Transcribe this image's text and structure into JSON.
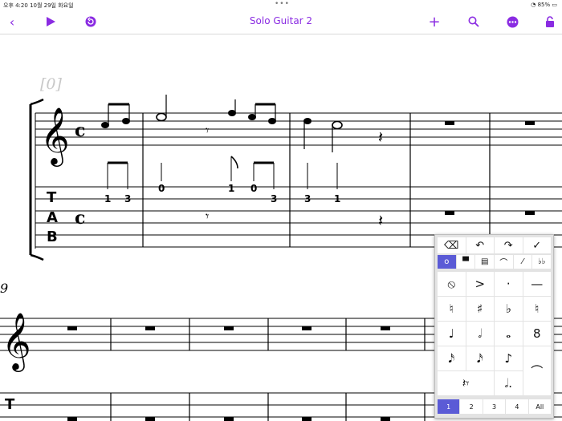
{
  "status": {
    "time": "오후 4:20",
    "date": "10월 29일 화요일",
    "dots": "•••",
    "wifi": "wifi-icon",
    "battery": "85%"
  },
  "toolbar": {
    "title": "Solo Guitar 2",
    "back_icon": "‹",
    "play_icon": "▶",
    "undo_icon": "↶",
    "add_icon": "+",
    "search_icon": "⌕",
    "more_icon": "•••",
    "lock_icon": "🔓"
  },
  "score": {
    "bar_label": "[0]",
    "system2_number": "9",
    "time_signature": "𝄴",
    "tab_label": [
      "T",
      "A",
      "B"
    ],
    "tab_numbers": [
      "1",
      "3",
      "0",
      "1",
      "0",
      "3",
      "3",
      "1"
    ]
  },
  "palette": {
    "top_row": [
      "⌫",
      "↶",
      "↷",
      "✓"
    ],
    "tabs": [
      "𝅝",
      "𝄼",
      "▤",
      "⌒",
      "⁄",
      "𝄫"
    ],
    "grid": [
      [
        "⦸",
        ">",
        "·",
        "—"
      ],
      [
        "♮",
        "♯",
        "♭",
        "♮"
      ],
      [
        "♩",
        "𝅗𝅥",
        "𝅝",
        "8"
      ],
      [
        "𝅘𝅥𝅯",
        "𝅘𝅥𝅯",
        "♪",
        "⌒"
      ],
      [
        "𝄽𝄾",
        "𝅗𝅥.",
        "",
        ""
      ]
    ],
    "voices": [
      "1",
      "2",
      "3",
      "4",
      "All"
    ],
    "selected_voice": "1",
    "colors": {
      "accent": "#8a2be2",
      "selection": "#5b5bd6"
    }
  }
}
